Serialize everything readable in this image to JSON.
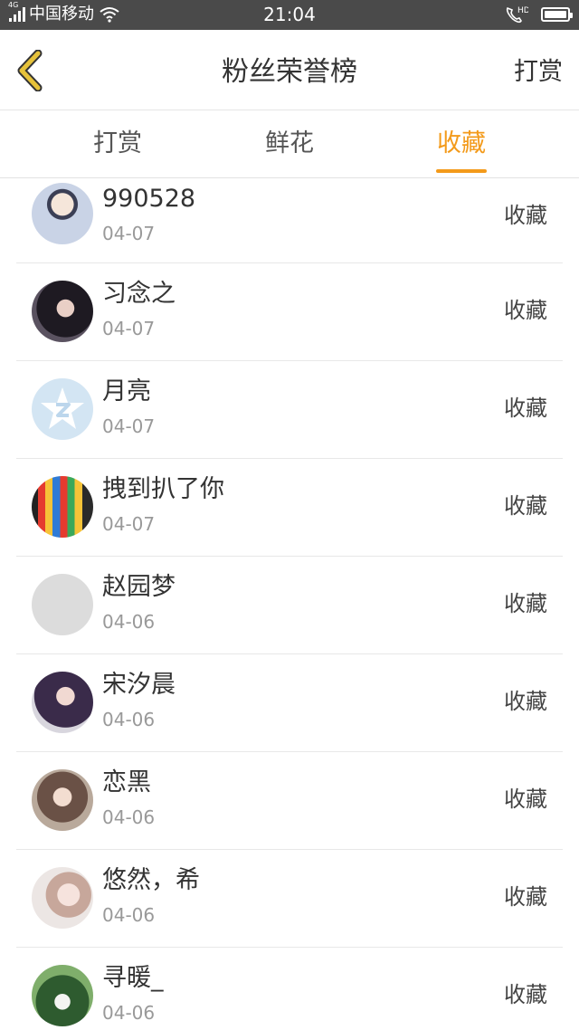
{
  "status_bar": {
    "network_type": "4G",
    "carrier": "中国移动",
    "time": "21:04",
    "hd_label": "HD"
  },
  "nav": {
    "title": "粉丝荣誉榜",
    "action": "打赏"
  },
  "tabs": [
    {
      "label": "打赏",
      "active": false
    },
    {
      "label": "鲜花",
      "active": false
    },
    {
      "label": "收藏",
      "active": true
    }
  ],
  "colors": {
    "accent": "#f39a1a",
    "back_icon": "#e6c23a",
    "status_bar": "#4a4a4a"
  },
  "fans": [
    {
      "name": "990528",
      "date": "04-07",
      "action": "收藏"
    },
    {
      "name": "习念之",
      "date": "04-07",
      "action": "收藏"
    },
    {
      "name": "月亮",
      "date": "04-07",
      "action": "收藏"
    },
    {
      "name": "拽到扒了你",
      "date": "04-07",
      "action": "收藏"
    },
    {
      "name": "赵园梦",
      "date": "04-06",
      "action": "收藏"
    },
    {
      "name": "宋汐晨",
      "date": "04-06",
      "action": "收藏"
    },
    {
      "name": "恋黑",
      "date": "04-06",
      "action": "收藏"
    },
    {
      "name": "悠然，希",
      "date": "04-06",
      "action": "收藏"
    },
    {
      "name": "寻暖_",
      "date": "04-06",
      "action": "收藏"
    }
  ]
}
